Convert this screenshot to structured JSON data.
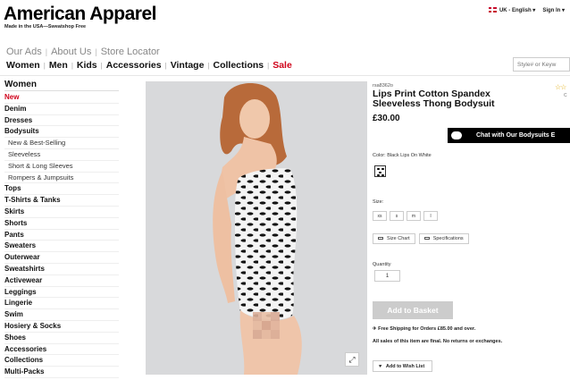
{
  "brand": {
    "logo": "American Apparel",
    "tagline": "Made in the USA—Sweatshop Free"
  },
  "topbar": {
    "locale": "UK - English",
    "signin": "Sign In"
  },
  "subnav": [
    "Our Ads",
    "About Us",
    "Store Locator"
  ],
  "mainnav": [
    "Women",
    "Men",
    "Kids",
    "Accessories",
    "Vintage",
    "Collections",
    "Sale"
  ],
  "search": {
    "placeholder": "Style# or Keyw"
  },
  "sidebar": {
    "heading": "Women",
    "items": [
      {
        "label": "New",
        "type": "new"
      },
      {
        "label": "Denim",
        "type": "main"
      },
      {
        "label": "Dresses",
        "type": "main"
      },
      {
        "label": "Bodysuits",
        "type": "main"
      },
      {
        "label": "New & Best-Selling",
        "type": "sub"
      },
      {
        "label": "Sleeveless",
        "type": "sub"
      },
      {
        "label": "Short & Long Sleeves",
        "type": "sub"
      },
      {
        "label": "Rompers & Jumpsuits",
        "type": "sub"
      },
      {
        "label": "Tops",
        "type": "main"
      },
      {
        "label": "T-Shirts & Tanks",
        "type": "main"
      },
      {
        "label": "Skirts",
        "type": "main"
      },
      {
        "label": "Shorts",
        "type": "main"
      },
      {
        "label": "Pants",
        "type": "main"
      },
      {
        "label": "Sweaters",
        "type": "main"
      },
      {
        "label": "Outerwear",
        "type": "main"
      },
      {
        "label": "Sweatshirts",
        "type": "main"
      },
      {
        "label": "Activewear",
        "type": "main"
      },
      {
        "label": "Leggings",
        "type": "main"
      },
      {
        "label": "Lingerie",
        "type": "main"
      },
      {
        "label": "Swim",
        "type": "main"
      },
      {
        "label": "Hosiery & Socks",
        "type": "main"
      },
      {
        "label": "Shoes",
        "type": "main"
      },
      {
        "label": "Accessories",
        "type": "main"
      },
      {
        "label": "Collections",
        "type": "main"
      },
      {
        "label": "Multi-Packs",
        "type": "main"
      }
    ]
  },
  "product": {
    "sku": "rsa8362o",
    "title": "Lips Print Cotton Spandex Sleeveless Thong Bodysuit",
    "price": "£30.00",
    "chat_label": "Chat with Our Bodysuits E",
    "rating_stars": "☆☆",
    "rating_sub": "C",
    "color_label": "Color: Black Lips On White",
    "size_label": "Size:",
    "sizes": [
      "xs",
      "s",
      "m",
      "l"
    ],
    "size_chart": "Size Chart",
    "specifications": "Specifications",
    "quantity_label": "Quantity",
    "quantity": "1",
    "add_to_basket": "Add to Basket",
    "shipping": "Free Shipping for Orders £85.00 and over.",
    "final_sale": "All sales of this item are final. No returns or exchanges.",
    "wishlist": "Add to Wish List"
  },
  "colors": {
    "sale": "#d0021b",
    "basket_disabled": "#cccccc",
    "chat_bg": "#000000"
  }
}
